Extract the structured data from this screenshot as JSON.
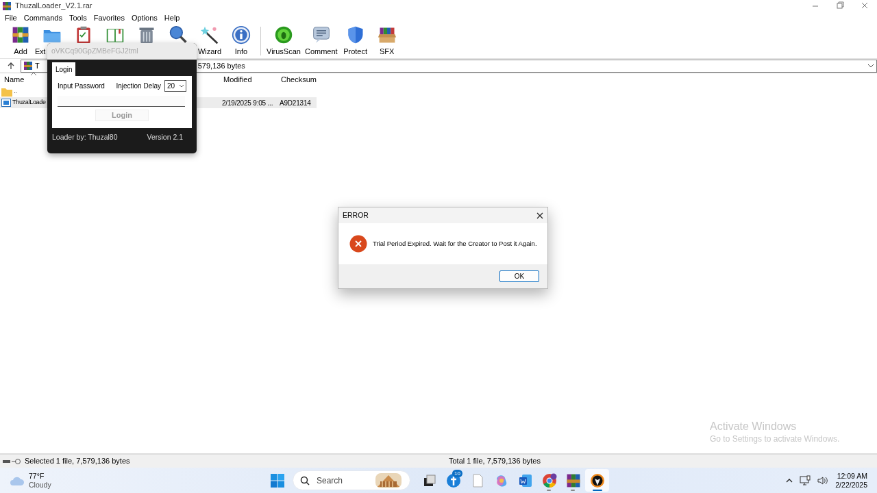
{
  "window": {
    "title": "ThuzalLoader_V2.1.rar"
  },
  "menu": [
    "File",
    "Commands",
    "Tools",
    "Favorites",
    "Options",
    "Help"
  ],
  "toolbar": [
    {
      "kind": "labeled",
      "label": "Add"
    },
    {
      "kind": "clipped",
      "label": "Ext"
    },
    {
      "kind": "icon-only"
    },
    {
      "kind": "icon-only"
    },
    {
      "kind": "icon-only"
    },
    {
      "kind": "icon-only"
    },
    {
      "kind": "labeled",
      "label": "Wizard"
    },
    {
      "kind": "labeled",
      "label": "Info"
    },
    {
      "kind": "separator"
    },
    {
      "kind": "labeled",
      "label": "VirusScan"
    },
    {
      "kind": "labeled",
      "label": "Comment"
    },
    {
      "kind": "labeled",
      "label": "Protect"
    },
    {
      "kind": "labeled",
      "label": "SFX"
    }
  ],
  "address": {
    "text_start": "T",
    "text_end": "579,136 bytes"
  },
  "file_list": {
    "columns": [
      {
        "label": "Name",
        "sorted": true
      },
      {
        "label": "Modified",
        "sorted": false
      },
      {
        "label": "Checksum",
        "sorted": false
      }
    ],
    "rows": [
      {
        "kind": "parent",
        "name": "..",
        "selected": false
      },
      {
        "kind": "file",
        "name": "ThuzalLoade",
        "modified": "2/19/2025 9:05 ...",
        "checksum": "A9D21314",
        "selected": true
      }
    ]
  },
  "login_window": {
    "title": "oVKCq90GpZMBeFGJ2tml",
    "tab": "Login",
    "password_label": "Input Password",
    "delay_label": "Injection Delay",
    "delay_value": "20",
    "button": "Login",
    "button_disabled": true,
    "author": "Loader by: Thuzal80",
    "version": "Version 2.1"
  },
  "error_dialog": {
    "title": "ERROR",
    "message": "Trial Period Expired. Wait for the Creator to Post it Again.",
    "button": "OK"
  },
  "watermark": {
    "title": "Activate Windows",
    "subtitle": "Go to Settings to activate Windows."
  },
  "status_bar": {
    "left": "Selected 1 file, 7,579,136 bytes",
    "right": "Total 1 file, 7,579,136 bytes"
  },
  "taskbar": {
    "weather": {
      "temp": "77°F",
      "condition": "Cloudy"
    },
    "search": {
      "placeholder": "Search"
    },
    "apps": [
      {
        "running": false,
        "active": false
      },
      {
        "badge": "10",
        "running": false,
        "active": false
      },
      {
        "running": false,
        "active": false
      },
      {
        "running": false,
        "active": false
      },
      {
        "running": false,
        "active": false
      },
      {
        "running": true,
        "active": false
      },
      {
        "running": true,
        "active": false
      },
      {
        "running": true,
        "active": true
      }
    ],
    "clock": {
      "time": "12:09 AM",
      "date": "2/22/2025"
    }
  }
}
